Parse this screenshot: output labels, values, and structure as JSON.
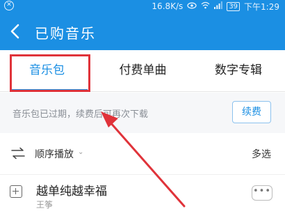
{
  "status_bar": {
    "left_icon": "circle-x-icon",
    "network_speed": "16.8K/s",
    "battery_level": "39",
    "time": "下午1:29"
  },
  "header": {
    "title": "已购音乐",
    "back_icon": "chevron-left-icon"
  },
  "tabs": [
    {
      "label": "音乐包",
      "active": true
    },
    {
      "label": "付费单曲",
      "active": false
    },
    {
      "label": "数字专辑",
      "active": false
    }
  ],
  "notice": {
    "text": "音乐包已过期，续费后可再次下载",
    "renew_label": "续费"
  },
  "toolbar": {
    "play_order_label": "顺序播放",
    "multi_select_label": "多选"
  },
  "songs": [
    {
      "title": "越单纯越幸福",
      "artist": "王筝"
    }
  ],
  "colors": {
    "brand_blue": "#1b8fe3",
    "annotation_red": "#e0333a"
  }
}
